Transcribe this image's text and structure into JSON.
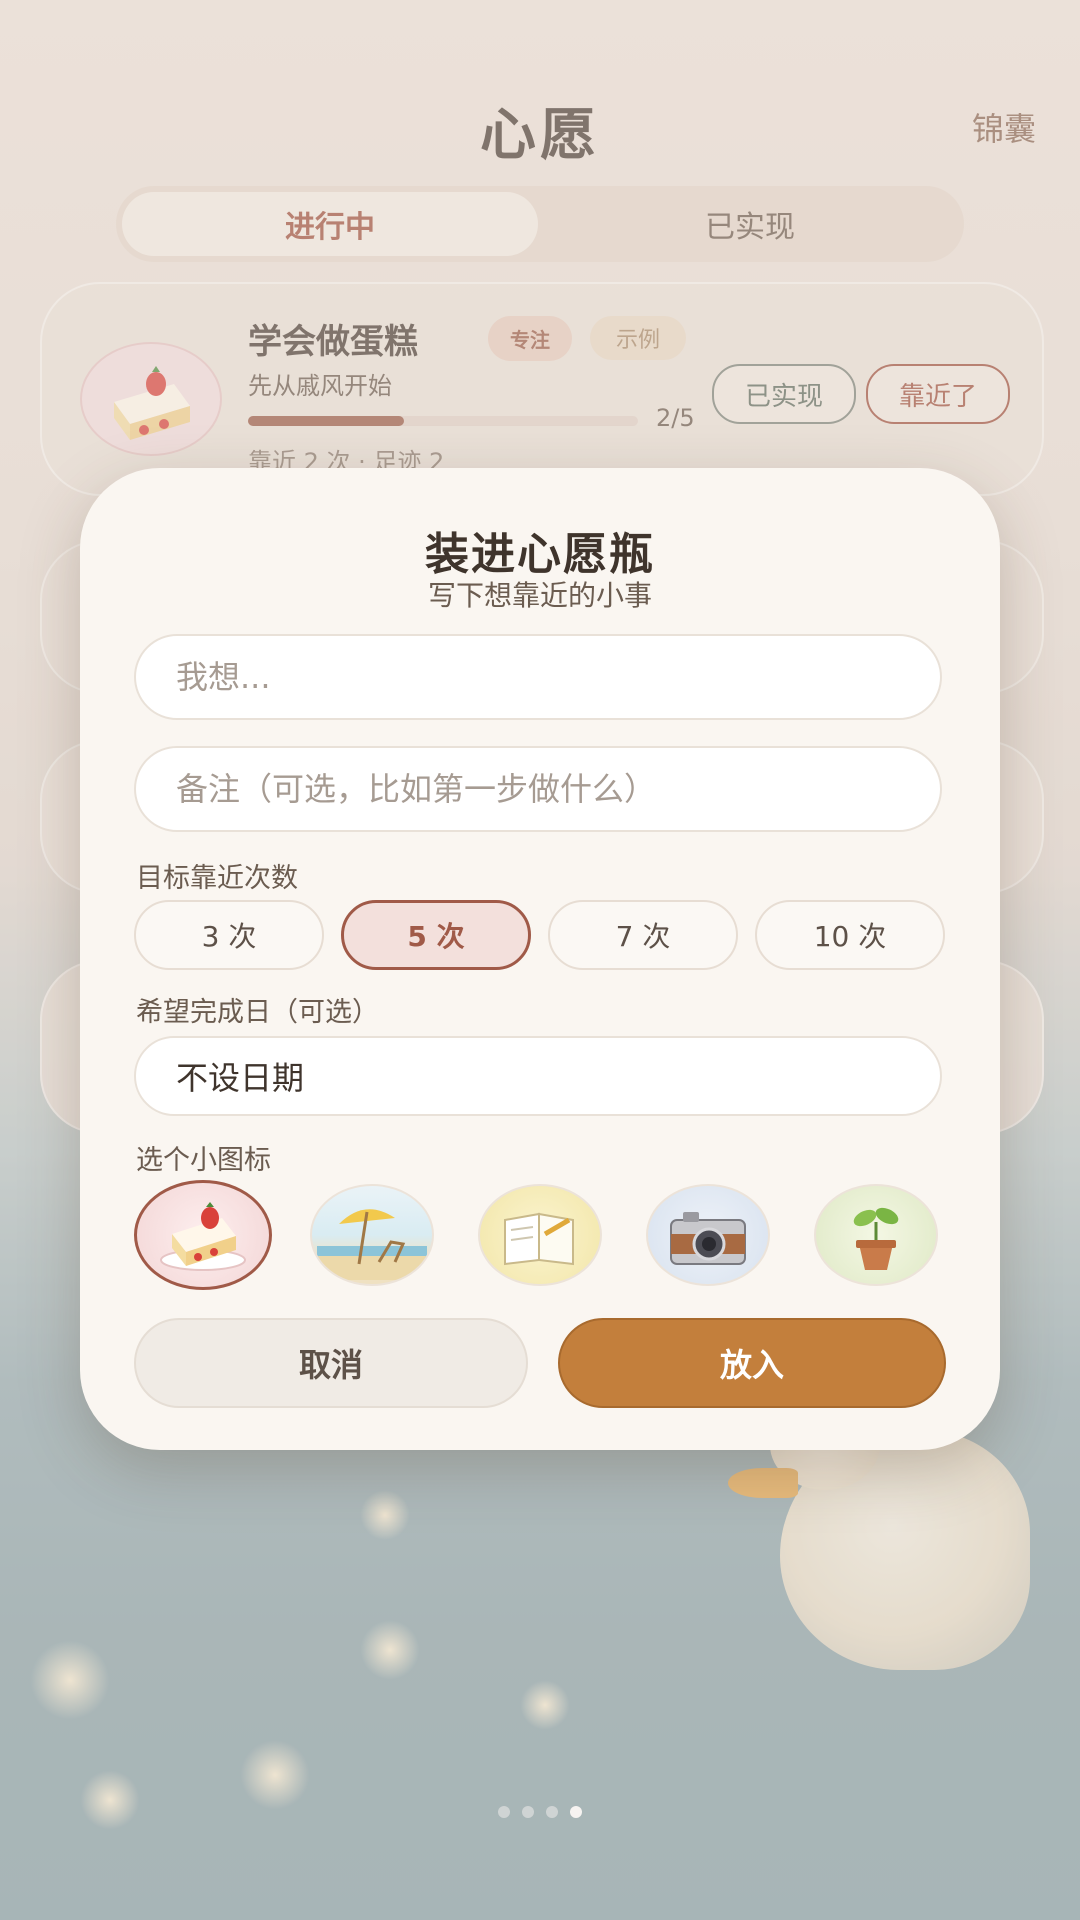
{
  "app": {
    "title": "心愿",
    "right_link": "锦囊",
    "tabs": [
      {
        "label": "进行中",
        "active": true
      },
      {
        "label": "已实现",
        "active": false
      }
    ]
  },
  "wish_card": {
    "title": "学会做蛋糕",
    "tag": "专注",
    "sample_tag": "示例",
    "subtitle": "先从戚风开始",
    "progress_text": "2/5",
    "progress_fraction": 0.4,
    "meta": "靠近 2 次 · 足迹 2",
    "done_button": "已实现",
    "near_button": "靠近了",
    "icon": "cake-icon"
  },
  "modal": {
    "title": "装进心愿瓶",
    "subtitle": "写下想靠近的小事",
    "wish_input": {
      "value": "",
      "placeholder": "我想..."
    },
    "note_input": {
      "value": "",
      "placeholder": "备注（可选，比如第一步做什么）"
    },
    "target_label": "目标靠近次数",
    "target_options": [
      {
        "label": "3 次",
        "selected": false
      },
      {
        "label": "5 次",
        "selected": true
      },
      {
        "label": "7 次",
        "selected": false
      },
      {
        "label": "10 次",
        "selected": false
      }
    ],
    "date_label": "希望完成日（可选）",
    "date_value": "不设日期",
    "icon_label": "选个小图标",
    "icon_options": [
      {
        "name": "cake-icon",
        "selected": true
      },
      {
        "name": "beach-umbrella-icon",
        "selected": false
      },
      {
        "name": "notebook-icon",
        "selected": false
      },
      {
        "name": "camera-icon",
        "selected": false
      },
      {
        "name": "sprout-icon",
        "selected": false
      }
    ],
    "cancel_button": "取消",
    "confirm_button": "放入"
  },
  "pager": {
    "count": 4,
    "active_index": 3
  },
  "colors": {
    "accent": "#c37f3c",
    "selected": "#a05a48",
    "modal_bg": "#faf6f1",
    "text": "#3f342c"
  }
}
